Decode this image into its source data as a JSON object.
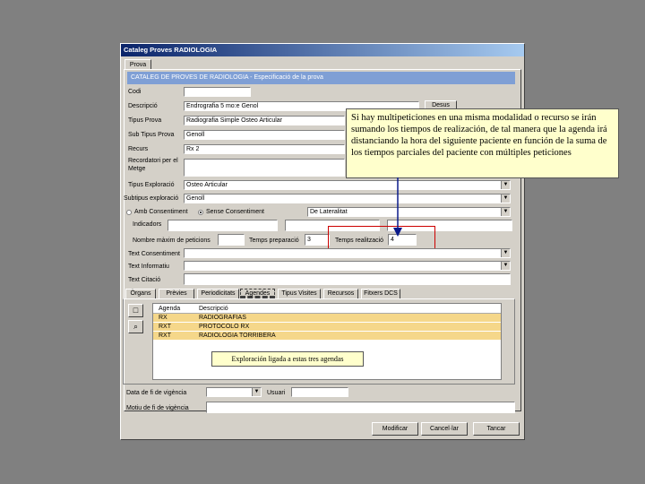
{
  "window": {
    "title": "Cataleg Proves RADIOLOGIA",
    "tab": "Prova"
  },
  "header": "CATALEG DE PROVES DE RADIOLOGIA - Especificació de la prova",
  "form": {
    "codi_label": "Codi",
    "codi_value": "",
    "descripcio_label": "Descripció",
    "descripcio_value": "Endrografia 5 mo:e Genol",
    "right_button": "Desus",
    "tipus_prova_label": "Tipus Prova",
    "tipus_prova_value": "Radiografia Simple Osteo Articular",
    "sub_tipus_label": "Sub Tipus Prova",
    "sub_tipus_value": "Genoll",
    "recurs_label": "Recurs",
    "recurs_value": "Rx 2",
    "recordatori_label": "Recordatori per el Metge",
    "tipus_exploracio_label": "Tipus Exploració",
    "tipus_exploracio_value": "Osteo Articular",
    "subtipus_exploracio_label": "Subtipus exploració",
    "subtipus_exploracio_value": "Genoll",
    "radio1": "Amb Consentiment",
    "radio2": "Sense Consentiment",
    "laterality_value": "De Lateralitat",
    "indicadors_label": "Indicadors",
    "nombre_label": "Nombre màxim de peticions",
    "nombre_value": "",
    "temps_prep_label": "Temps preparació",
    "temps_prep_value": "3",
    "temps_real_label": "Temps realització",
    "temps_real_value": "4",
    "text_consent_label": "Text Consentiment",
    "text_inform_label": "Text Informatiu",
    "text_citacio_label": "Text Citació"
  },
  "tabs": [
    "Òrgans",
    "Prèvies",
    "Periodicitats",
    "Agendes",
    "Tipus Visites",
    "Recursos",
    "Fitxers DCS"
  ],
  "grid": {
    "headers": [
      "Agenda",
      "Descripció"
    ],
    "rows": [
      [
        "RX",
        "RADIOGRAFIAS"
      ],
      [
        "RXT",
        "PROTOCOLO RX"
      ],
      [
        "RXT",
        "RADIOLOGIA TORRIBERA"
      ]
    ]
  },
  "bottom": {
    "data_label": "Data de fi de vigència",
    "usuari_label": "Usuari",
    "motiu_label": "Motiu de fi de vigència",
    "buttons": [
      "Modificar",
      "Cancel·lar",
      "Tancar"
    ]
  },
  "callout": "Si hay multipeticiones en una misma modalidad o recurso se irán sumando los tiempos de realización, de tal manera que la agenda irá distanciando la hora del siguiente paciente en función de la suma de los tiempos parciales del paciente con múltiples peticiones",
  "note": "Exploración ligada a estas tres agendas",
  "colors": {
    "highlight": "#f5d78a",
    "header_bar": "#7f9fd5",
    "callout_bg": "#ffffcc",
    "annotation_red": "#cc0000",
    "arrow": "#0a1a8a"
  }
}
